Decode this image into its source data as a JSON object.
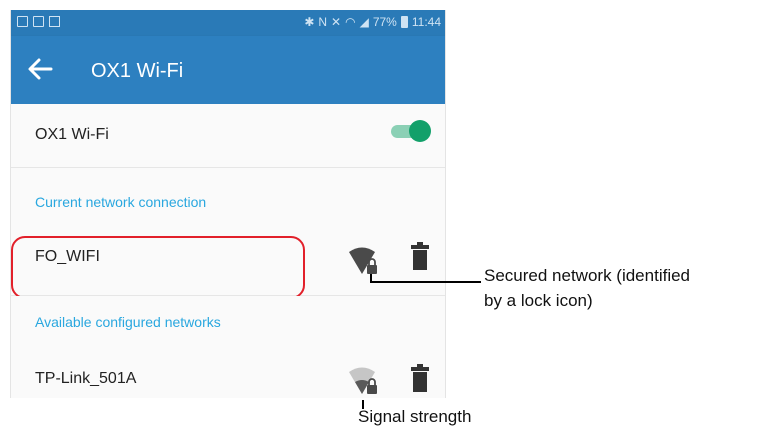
{
  "status_bar": {
    "battery": "77%",
    "time": "11:44"
  },
  "app_bar": {
    "title": "OX1 Wi-Fi"
  },
  "wifi_toggle": {
    "label": "OX1 Wi-Fi",
    "enabled": true
  },
  "sections": {
    "current": "Current network connection",
    "available": "Available configured networks"
  },
  "current_network": {
    "ssid": "FO_WIFI",
    "secured": true
  },
  "configured_networks": [
    {
      "ssid": "TP-Link_501A",
      "secured": true
    }
  ],
  "annotations": {
    "secured_line1": "Secured network (identified",
    "secured_line2": "by a lock icon)",
    "signal": "Signal strength"
  },
  "colors": {
    "status_bar": "#2a7ab7",
    "app_bar": "#2d80c0",
    "accent_text": "#29a7df",
    "toggle_on": "#12a06a",
    "highlight": "#e2202a"
  }
}
